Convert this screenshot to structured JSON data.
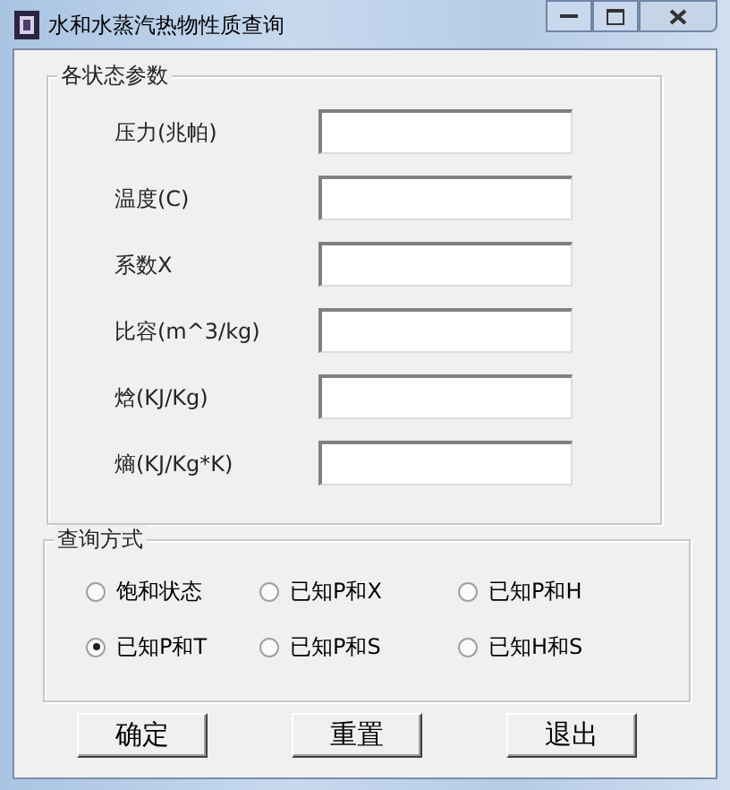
{
  "window": {
    "title": "水和水蒸汽热物性质查询"
  },
  "parameters": {
    "title": "各状态参数",
    "fields": [
      {
        "label": "压力(兆帕)"
      },
      {
        "label": "温度(C)"
      },
      {
        "label": "系数X"
      },
      {
        "label": "比容(m^3/kg)"
      },
      {
        "label": "焓(KJ/Kg)"
      },
      {
        "label": "熵(KJ/Kg*K)"
      }
    ]
  },
  "query_mode": {
    "title": "查询方式",
    "options": [
      {
        "label": "饱和状态",
        "selected": false
      },
      {
        "label": "已知P和X",
        "selected": false
      },
      {
        "label": "已知P和H",
        "selected": false
      },
      {
        "label": "已知P和T",
        "selected": true
      },
      {
        "label": "已知P和S",
        "selected": false
      },
      {
        "label": "已知H和S",
        "selected": false
      }
    ]
  },
  "buttons": [
    {
      "label": "确定"
    },
    {
      "label": "重置"
    },
    {
      "label": "退出"
    }
  ]
}
